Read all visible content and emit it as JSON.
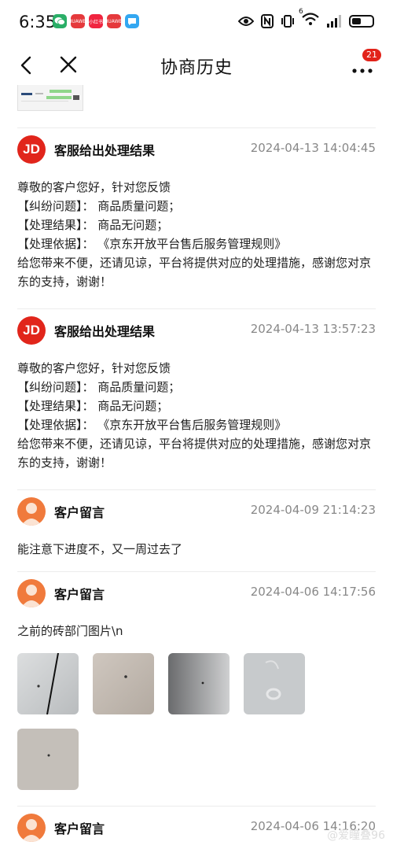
{
  "status": {
    "time": "6:35",
    "network": "6",
    "app_icons": [
      {
        "name": "wechat-icon",
        "color": "#2aae67",
        "label": ""
      },
      {
        "name": "huawei-icon-1",
        "color": "#e5393c",
        "label": "HUAWEI"
      },
      {
        "name": "xiaohongshu-icon",
        "color": "#f0243f",
        "label": "小红书"
      },
      {
        "name": "huawei-icon-2",
        "color": "#e5393c",
        "label": "HUAWEI"
      },
      {
        "name": "message-icon",
        "color": "#33a7f1",
        "label": ""
      }
    ]
  },
  "header": {
    "title": "协商历史",
    "badge": "21"
  },
  "entries": [
    {
      "type": "jd",
      "avatar_text": "JD",
      "title": "客服给出处理结果",
      "time": "2024-04-13 14:04:45",
      "lines": [
        "尊敬的客户您好，针对您反馈",
        "【纠纷问题】： 商品质量问题；",
        "【处理结果】： 商品无问题；",
        "【处理依据】： 《京东开放平台售后服务管理规则》",
        "给您带来不便，还请见谅，平台将提供对应的处理措施，感谢您对京东的支持，谢谢！"
      ]
    },
    {
      "type": "jd",
      "avatar_text": "JD",
      "title": "客服给出处理结果",
      "time": "2024-04-13 13:57:23",
      "lines": [
        "尊敬的客户您好，针对您反馈",
        "【纠纷问题】： 商品质量问题；",
        "【处理结果】： 商品无问题；",
        "【处理依据】： 《京东开放平台售后服务管理规则》",
        "给您带来不便，还请见谅，平台将提供对应的处理措施，感谢您对京东的支持，谢谢！"
      ]
    },
    {
      "type": "user",
      "title": "客户留言",
      "time": "2024-04-09 21:14:23",
      "lines": [
        "能注意下进度不，又一周过去了"
      ]
    },
    {
      "type": "user",
      "title": "客户留言",
      "time": "2024-04-06 14:17:56",
      "lines": [
        "之前的砖部门图片\\n"
      ],
      "photos": 5
    },
    {
      "type": "user",
      "title": "客户留言",
      "time": "2024-04-06 14:16:20",
      "lines": []
    }
  ],
  "watermark": "@爱瞳叠96",
  "colors": {
    "jd_red": "#e1251b",
    "user_orange": "#f07a3c",
    "time_gray": "#888888"
  }
}
